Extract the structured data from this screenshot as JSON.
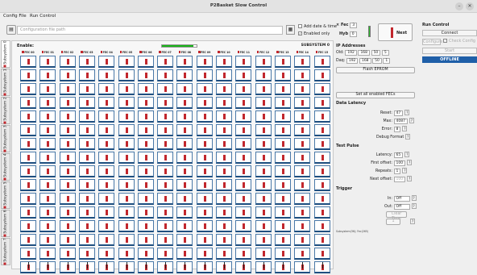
{
  "window": {
    "title": "P2Basket Slow Control"
  },
  "menu": {
    "config": "Config File",
    "run": "Run Control"
  },
  "toolbar": {
    "config_placeholder": "Configuration file path",
    "add_date_label": "Add date & time",
    "enabled_only_label": "Enabled only"
  },
  "tabs": [
    "Subsystem 0",
    "Subsystem 1",
    "Subsystem 2",
    "Subsystem 3",
    "Subsystem 4",
    "Subsystem 5",
    "Subsystem 6",
    "Subsystem 7"
  ],
  "grid": {
    "enable_label": "Enable:",
    "progress": 0.9,
    "subsystem_title": "SUBSYSTEM 0",
    "fecs": [
      "FEC 00",
      "FEC 01",
      "FEC 02",
      "FEC 03",
      "FEC 04",
      "FEC 05",
      "FEC 06",
      "FEC 07",
      "FEC 08",
      "FEC 09",
      "FEC 10",
      "FEC 11",
      "FEC 12",
      "FEC 13",
      "FEC 14",
      "FEC 15"
    ],
    "rows": 16
  },
  "panel": {
    "fec_label": "Fec",
    "fec_value": "3",
    "hyb_label": "Hyb",
    "hyb_value": "0",
    "next_label": "Next",
    "ip_title": "IP Addresses",
    "old_label": "Old:",
    "old_ip": [
      "192",
      "168",
      "50",
      "5"
    ],
    "daq_label": "Daq:",
    "daq_ip": [
      "192",
      "168",
      "50",
      "1"
    ],
    "flash": "Flash EPROM",
    "set_all": "Set all enabled FECs",
    "latency_title": "Data Latency",
    "reset_label": "Reset:",
    "reset_value": "47",
    "max_label": "Max:",
    "max_value": "4087",
    "error_label": "Error:",
    "error_value": "8",
    "debug_format": "Debug Format",
    "test_pulse_title": "Test Pulse",
    "latency_label": "Latency:",
    "latency_value": "65",
    "first_offset_label": "First offset:",
    "first_offset_value": "100",
    "repeats_label": "Repeats:",
    "repeats_value": "1",
    "next_offset_label": "Next offset:",
    "next_offset_value": "100",
    "trigger_title": "Trigger",
    "in_label": "In:",
    "in_value": "Off",
    "out_label": "Out:",
    "out_value": "Off",
    "clear_time": "Clear Time",
    "q": "?",
    "footnote": "Subsystem(36); Fec(265)"
  },
  "run_control": {
    "title": "Run Control",
    "connect": "Connect",
    "configure": "Configure",
    "check_config": "Check Config",
    "start": "Start",
    "status": "OFFLINE"
  }
}
